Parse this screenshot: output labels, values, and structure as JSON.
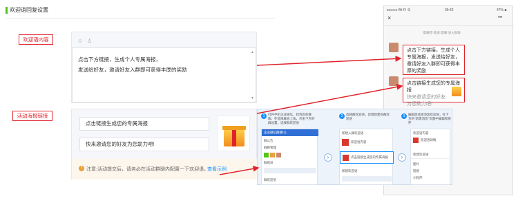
{
  "header": {
    "title": "欢迎语回复设置"
  },
  "welcome": {
    "label": "欢迎语内容",
    "line1": "点击下方链接，生成个人专属海报，",
    "line2": "发送给好友，邀请好友入群即可获得丰厚的奖励"
  },
  "activity": {
    "label": "活动海报链接",
    "link_title": "点击链接生成您的专属海报",
    "link_desc": "快来邀请您的好友为您助力吧!",
    "notice": "注意:活动提交后，请务必在活动群聊内配置一下欢迎语。",
    "notice_link": "查看示例"
  },
  "phone": {
    "status_left": "●●●●● Wi-Fi 令",
    "time": "09:42",
    "battery": "47% ■",
    "close": "×",
    "more": "•••",
    "system_msg": "\"晨曦苑\"邀请\"晨曦\"进入群聊",
    "bubble1": "点击下方链接，生成个人专属海报，发送给好友，邀请好友入群即可获得丰厚的奖励",
    "bubble2_title": "点击链接生成您的专属海报",
    "bubble2_desc": "快来邀请您的好友为您助力吧!"
  },
  "guide": {
    "step1": "打开手机企业微信，找到您的群聊，在选择群会上角，点击下方的群设置，选择群欢迎语",
    "step2": "选择群欢迎语，您想新建的群欢迎语",
    "step3": "编辑后选择添加欢迎语，在下方的\"新建消息\"页面中编辑和保存",
    "s1_card_title": "企业微信群聊(1)",
    "s1_rows": [
      "群公告",
      "群聊管理",
      "群成员",
      "群欢迎语"
    ],
    "s2_rows": [
      "新建入群欢迎语",
      "欢迎语内容",
      "新建欢迎语"
    ],
    "s2_highlight": "点击链接生成您的专属海报",
    "s3_rows": [
      "欢迎语内容",
      "欢迎语详情",
      "新建欢迎语",
      "图片",
      "链接",
      "小程序"
    ]
  },
  "colors": {
    "accent": "#52c41a",
    "highlight": "#e0232b",
    "link": "#1890ff"
  }
}
